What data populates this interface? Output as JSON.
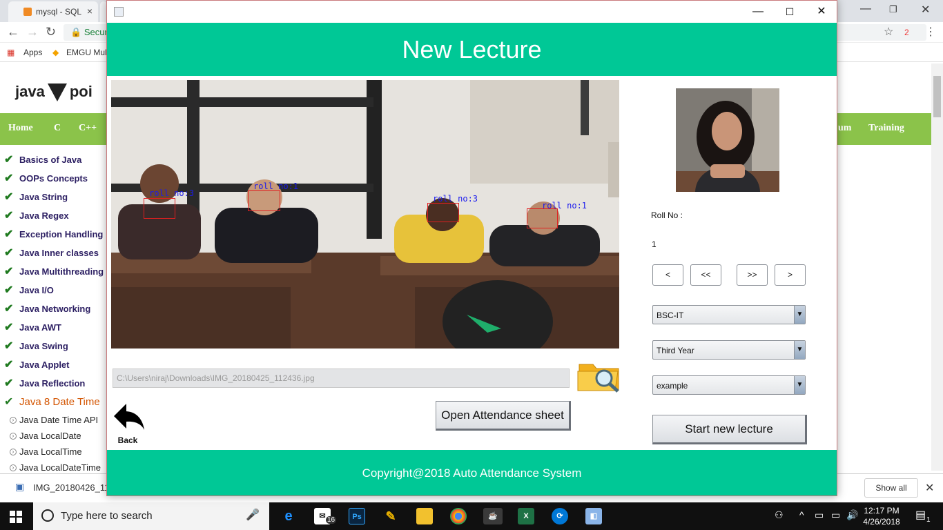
{
  "browser": {
    "tab1_title": "mysql - SQL",
    "url_prefix": "Secur",
    "bookmarks": {
      "apps": "Apps",
      "emgu": "EMGU Mul"
    },
    "ext_badge": "2"
  },
  "site": {
    "logo_left": "java",
    "logo_right": "poi",
    "nav": [
      "Home",
      "C",
      "C++",
      "um",
      "Training"
    ],
    "menu": [
      "Basics of Java",
      "OOPs Concepts",
      "Java String",
      "Java Regex",
      "Exception Handling",
      "Java Inner classes",
      "Java Multithreading",
      "Java I/O",
      "Java Networking",
      "Java AWT",
      "Java Swing",
      "Java Applet",
      "Java Reflection",
      "Java 8 Date Time"
    ],
    "submenu": [
      "Java Date Time API",
      "Java LocalDate",
      "Java LocalTime",
      "Java LocalDateTime"
    ],
    "download_file": "IMG_20180426_11",
    "show_all": "Show all"
  },
  "app": {
    "header_title": "New Lecture",
    "photo_labels": [
      "roll no:3",
      "roll no:1",
      "roll no:3",
      "roll no:1"
    ],
    "file_path": "C:\\Users\\niraj\\Downloads\\IMG_20180425_112436.jpg",
    "back_label": "Back",
    "open_sheet_label": "Open Attendance sheet",
    "roll_label": "Roll No :",
    "roll_value": "1",
    "nav_buttons": [
      "<",
      "<<",
      ">>",
      ">"
    ],
    "combo_course": "BSC-IT",
    "combo_year": "Third Year",
    "combo_subject": "example",
    "start_label": "Start new lecture",
    "footer_text": "Copyright@2018 Auto Attendance System"
  },
  "taskbar": {
    "search_placeholder": "Type here to search",
    "mail_badge": "16",
    "time": "12:17 PM",
    "date": "4/26/2018",
    "notif_count": "1"
  },
  "colors": {
    "accent": "#00c896",
    "site_nav": "#8bc34a",
    "face_box": "#e02020",
    "face_label": "#1a1aee"
  }
}
